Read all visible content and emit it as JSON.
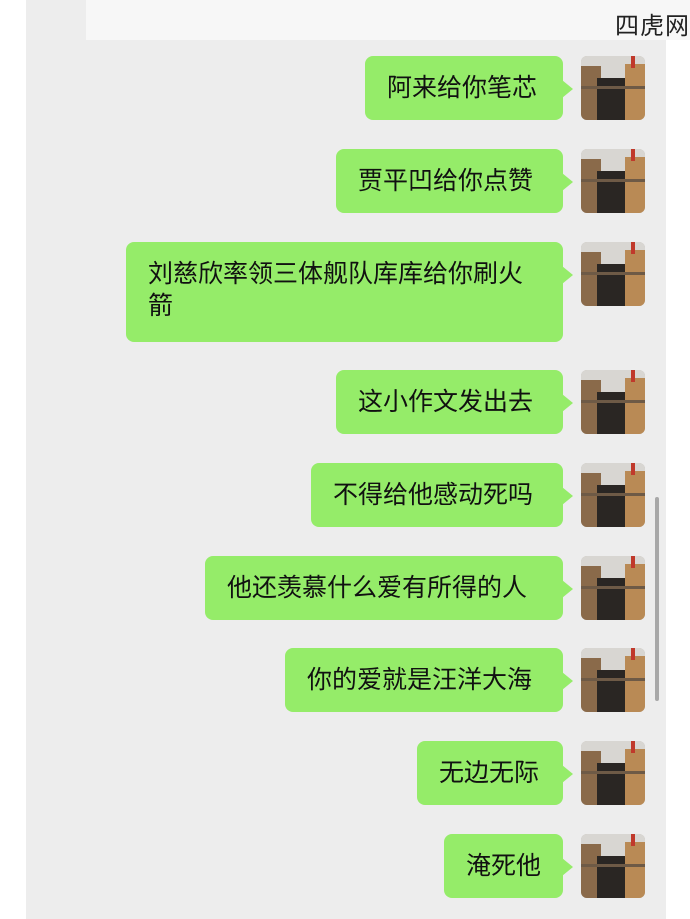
{
  "watermark": "四虎网",
  "messages": [
    {
      "text": "阿来给你笔芯"
    },
    {
      "text": "贾平凹给你点赞"
    },
    {
      "text": "刘慈欣率领三体舰队库库给你刷火箭"
    },
    {
      "text": "这小作文发出去"
    },
    {
      "text": "不得给他感动死吗"
    },
    {
      "text": "他还羡慕什么爱有所得的人"
    },
    {
      "text": "你的爱就是汪洋大海"
    },
    {
      "text": "无边无际"
    },
    {
      "text": "淹死他"
    }
  ],
  "colors": {
    "bubble": "#95ec69",
    "background": "#ededed"
  }
}
